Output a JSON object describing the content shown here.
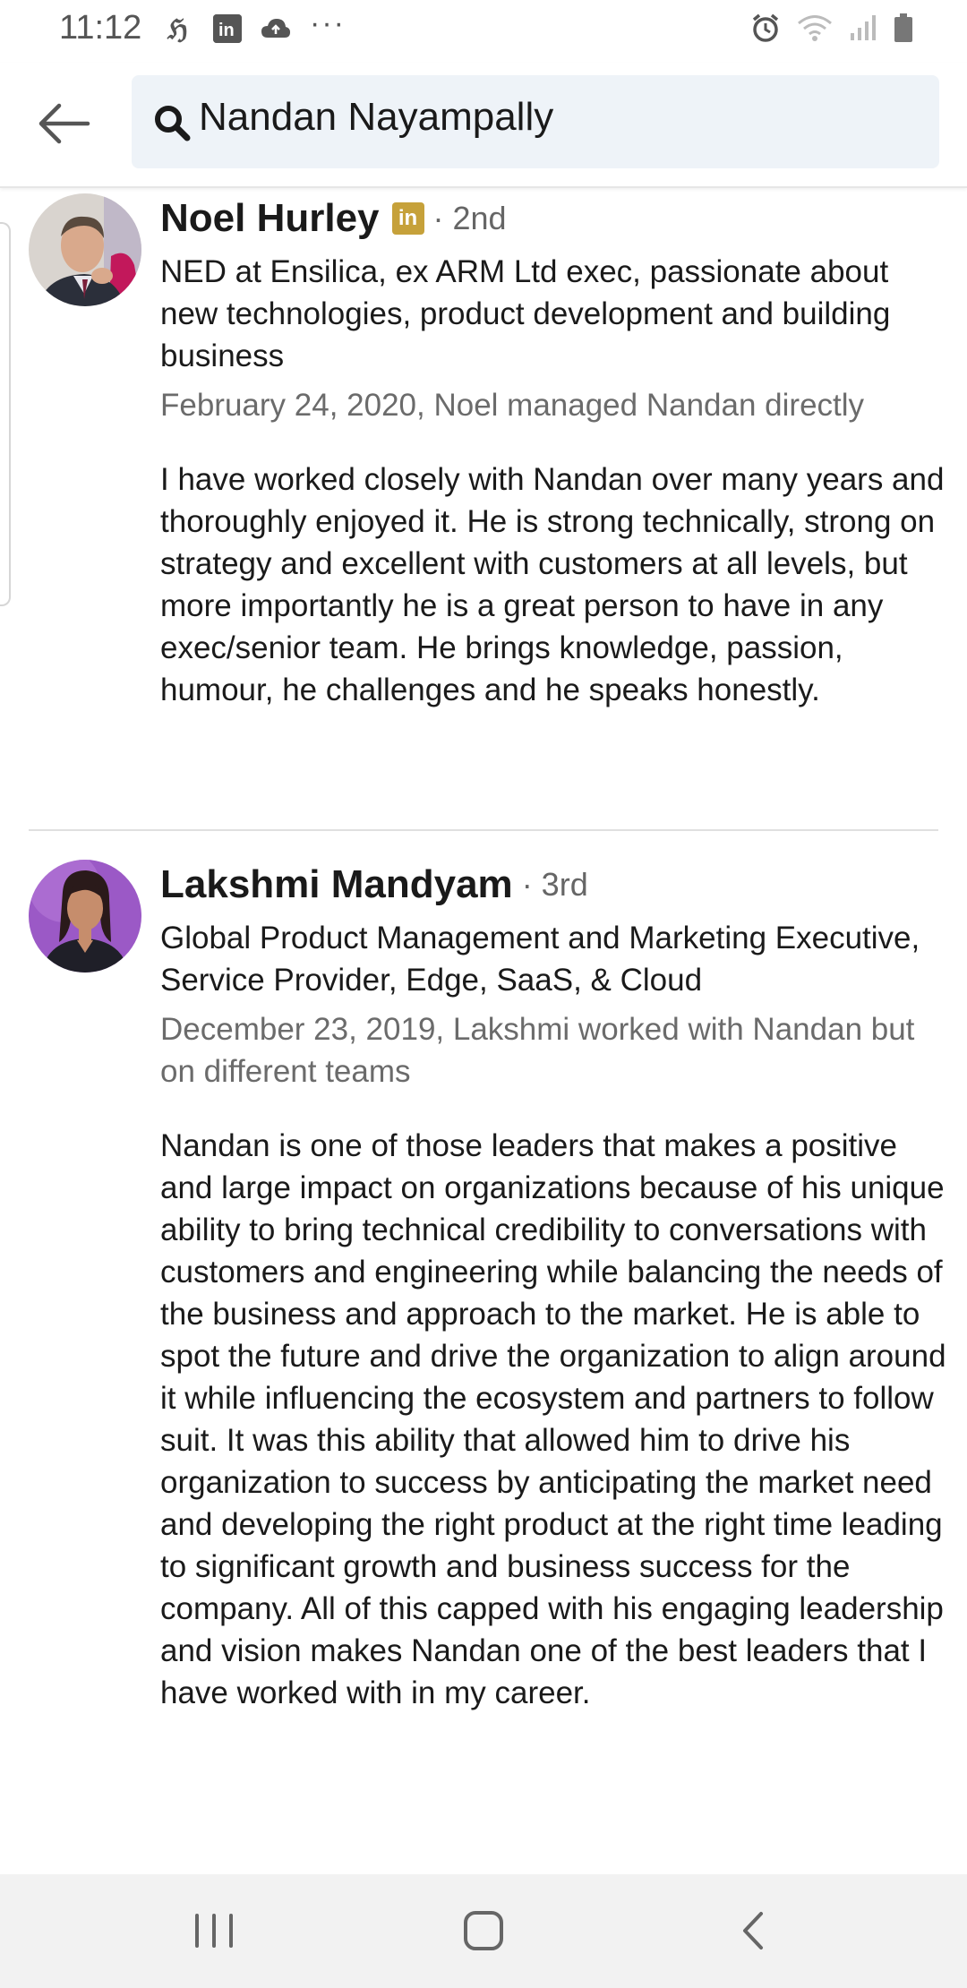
{
  "status_bar": {
    "time": "11:12",
    "more": "···"
  },
  "search": {
    "query": "Nandan Nayampally"
  },
  "recommendations": [
    {
      "name": "Noel Hurley",
      "badge": "in",
      "degree": "· 2nd",
      "headline": "NED at Ensilica, ex ARM Ltd exec,  passionate about new technologies, product development and building business",
      "meta": "February 24, 2020, Noel managed Nandan directly",
      "text": "I have worked closely with Nandan over many years and thoroughly enjoyed it. He is strong technically, strong on strategy and excellent with customers at all levels, but more importantly he is a great person to have in any exec/senior team. He brings knowledge, passion, humour, he challenges and he speaks honestly."
    },
    {
      "name": "Lakshmi Mandyam",
      "degree": "· 3rd",
      "headline": "Global Product Management and Marketing Executive, Service Provider, Edge, SaaS, & Cloud",
      "meta": "December 23, 2019, Lakshmi worked with Nandan but on different teams",
      "text": "Nandan is one of those leaders that makes a positive and large impact on organizations because of his unique ability to bring technical credibility to conversations with customers and engineering while balancing the needs of the business and approach to the market. He is able to spot the future and drive the organization to align around it while influencing the ecosystem and partners to follow suit. It was this ability that allowed him to drive his organization to success by anticipating the market need and developing the right product at the right time leading to significant growth and business success for the company. All of this capped with his engaging leadership and vision makes Nandan one of the best leaders that I have worked with in my career."
    }
  ],
  "icons": {
    "back": "arrow-left-icon",
    "search": "search-icon",
    "nav_recents": "recents-icon",
    "nav_home": "home-icon",
    "nav_back": "chevron-left-icon"
  },
  "colors": {
    "badge_gold": "#c6a13a",
    "search_bg": "#eef3f8"
  }
}
